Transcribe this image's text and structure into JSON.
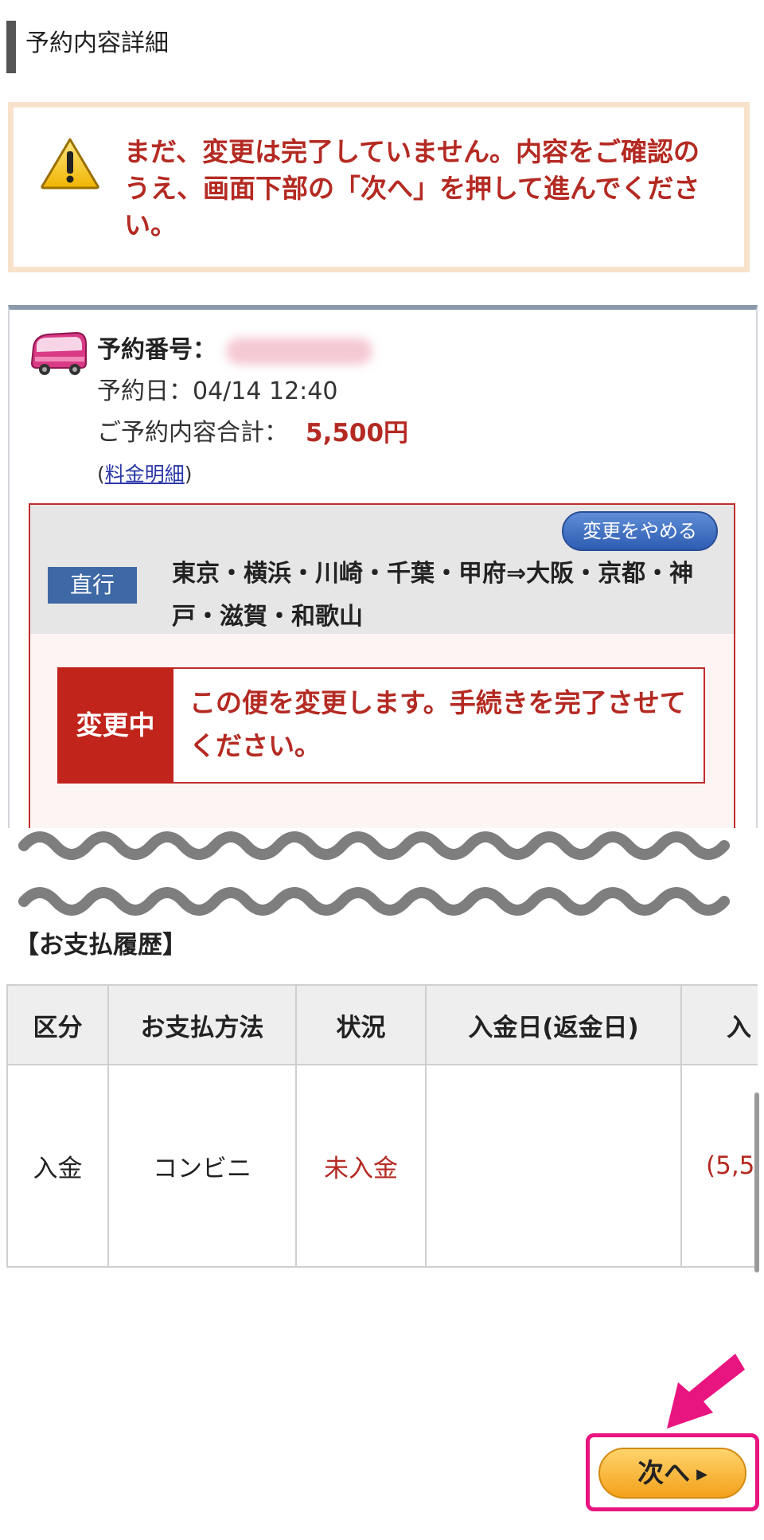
{
  "header": {
    "title": "予約内容詳細"
  },
  "warning": {
    "icon": "warning-triangle-icon",
    "message": "まだ、変更は完了していません。内容をご確認のうえ、画面下部の「次へ」を押して進んでください。"
  },
  "reservation": {
    "number_label": "予約番号：",
    "date_text": "予約日：04/14 12:40",
    "total_label": "ご予約内容合計：",
    "total_value": "5,500円",
    "fee_link_prefix": "(",
    "fee_link": "料金明細",
    "fee_link_suffix": ")"
  },
  "trip": {
    "cancel_change_label": "変更をやめる",
    "type_badge": "直行",
    "route": "東京・横浜・川崎・千葉・甲府⇒大阪・京都・神戸・滋賀・和歌山",
    "status_tag": "変更中",
    "status_message": "この便を変更します。手続きを完了させてください。"
  },
  "payment": {
    "title": "【お支払履歴】",
    "columns": [
      "区分",
      "お支払方法",
      "状況",
      "入金日(返金日)",
      "入"
    ],
    "rows": [
      {
        "category": "入金",
        "method": "コンビニ",
        "status": "未入金",
        "date": "",
        "amount": "(5,5"
      }
    ]
  },
  "next_button": {
    "label": "次へ"
  },
  "colors": {
    "accent_red": "#b42a22",
    "highlight_pink": "#e8147f",
    "button_orange": "#f3a11b"
  }
}
